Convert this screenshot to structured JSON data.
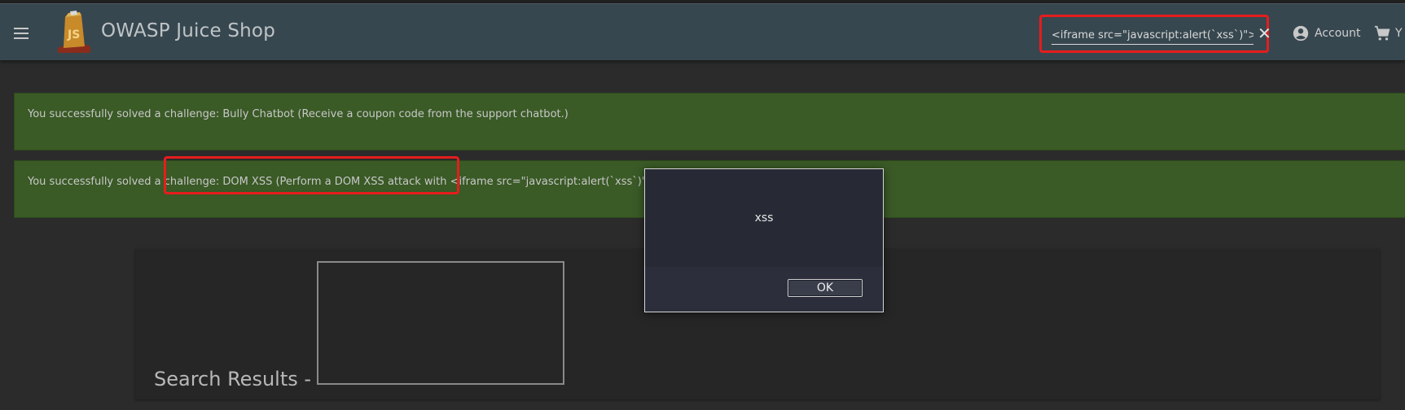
{
  "toolbar": {
    "menu_icon": "menu-icon",
    "app_title": "OWASP Juice Shop",
    "search": {
      "value": "<iframe src=\"javascript:alert(`xss`)\">",
      "clear_icon": "close-icon"
    },
    "account_label": "Account",
    "basket_label": "Y"
  },
  "banners": [
    {
      "text": "You successfully solved a challenge: Bully Chatbot (Receive a coupon code from the support chatbot.)"
    },
    {
      "text": "You successfully solved a challenge: DOM XSS (Perform a DOM XSS attack with <iframe src=\"javascript:alert(`xss`)\">.)"
    }
  ],
  "results": {
    "title": "Search Results -"
  },
  "dialog": {
    "message": "xss",
    "ok_label": "OK"
  },
  "colors": {
    "toolbar": "#37474f",
    "banner": "#3a5a26",
    "highlight": "#e51d1d"
  }
}
